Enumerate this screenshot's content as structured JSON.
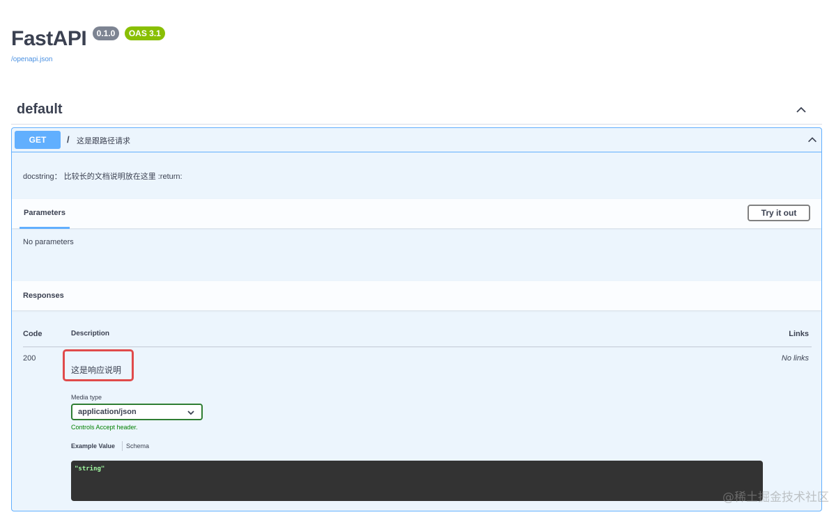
{
  "header": {
    "title": "FastAPI",
    "version_badge": "0.1.0",
    "oas_badge": "OAS 3.1",
    "spec_link": "/openapi.json"
  },
  "tag": {
    "name": "default",
    "toggle_icon": "chevron-up-icon"
  },
  "operation": {
    "method": "GET",
    "path": "/",
    "summary": "这是跟路径请求",
    "description": "docstring：  比较长的文档说明放在这里 :return:",
    "toggle_icon": "chevron-up-icon",
    "parameters_tab": "Parameters",
    "try_it_out_label": "Try it out",
    "no_parameters": "No parameters",
    "responses_title": "Responses",
    "table": {
      "headers": {
        "code": "Code",
        "description": "Description",
        "links": "Links"
      },
      "rows": [
        {
          "code": "200",
          "description": "这是响应说明",
          "links": "No links",
          "media_type_label": "Media type",
          "media_type_value": "application/json",
          "controls_accept": "Controls Accept header.",
          "example_tab": "Example Value",
          "schema_tab": "Schema",
          "example_code": "\"string\""
        }
      ]
    }
  },
  "watermark": "@稀土掘金技术社区",
  "colors": {
    "get_method": "#61affe",
    "get_background": "#ecf5fd",
    "oas_badge": "#89bf04",
    "version_badge": "#7d8492",
    "highlight_box": "#e04b4b",
    "code_block": "#333333"
  }
}
